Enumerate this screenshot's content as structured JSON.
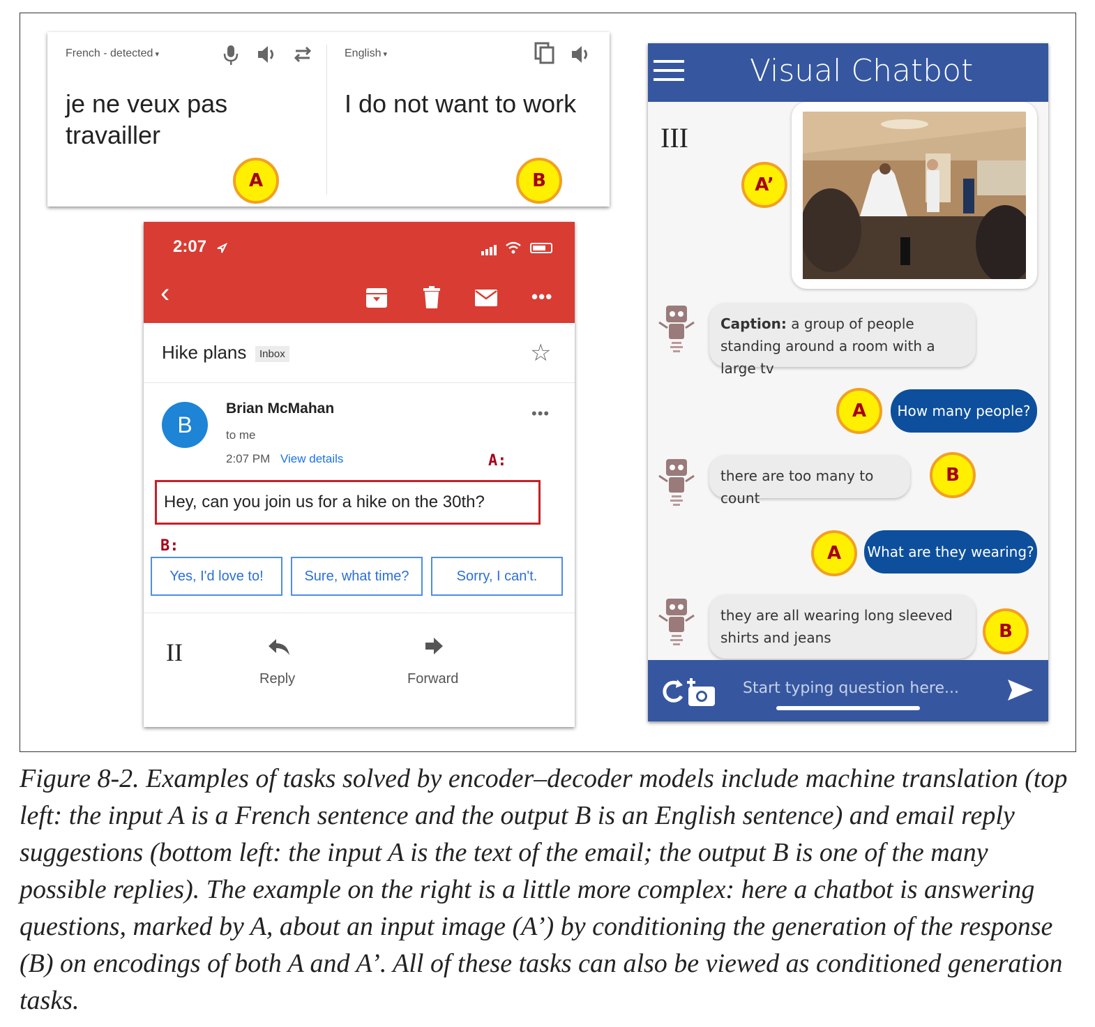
{
  "translate": {
    "source_lang": "French - detected",
    "target_lang": "English",
    "source_text": "je ne veux pas travailler",
    "target_text": "I do not want to work",
    "badge_a": "A",
    "badge_b": "B"
  },
  "email": {
    "time": "2:07",
    "subject": "Hike plans",
    "inbox_tag": "Inbox",
    "avatar_letter": "B",
    "sender": "Brian McMahan",
    "recipient": "to me",
    "sent_time": "2:07 PM",
    "view_details": "View details",
    "label_a": "A:",
    "label_b": "B:",
    "body": "Hey, can you join us for a hike on the 30th?",
    "replies": [
      "Yes, I'd love to!",
      "Sure, what time?",
      "Sorry, I can't."
    ],
    "roman": "II",
    "reply_label": "Reply",
    "forward_label": "Forward"
  },
  "chat": {
    "title": "Visual Chatbot",
    "roman": "III",
    "badge_a_prime": "A’",
    "caption_label": "Caption:",
    "caption_text": " a group of people standing around a room with a large tv",
    "question1": "How many people?",
    "answer1": "there are too many to count",
    "question2": "What are they wearing?",
    "answer2": "they are all wearing long sleeved shirts and jeans",
    "badge_a": "A",
    "badge_b": "B",
    "input_placeholder": "Start typing question here..."
  },
  "figure_caption": "Figure 8-2. Examples of tasks solved by encoder–decoder models include machine translation (top left: the input A is a French sentence and the output B is an English sentence) and email reply suggestions (bottom left: the input A is the text of the email; the output B is one of the many possible replies). The example on the right is a little more complex: here a chatbot is answering questions, marked by A, about an input image (A’) by conditioning the generation of the response (B) on encodings of both A and A’. All of these tasks can also be viewed as conditioned generation tasks.",
  "colors": {
    "gmail_red": "#d93c32",
    "chatbot_blue": "#3657a0",
    "user_bubble": "#0d4f9c",
    "badge_yellow": "#ffef00",
    "badge_orange": "#f2a024",
    "badge_text": "#a5001a"
  }
}
